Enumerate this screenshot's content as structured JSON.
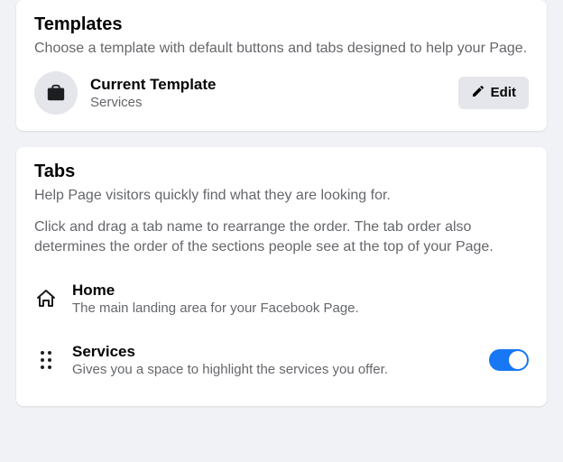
{
  "templates": {
    "title": "Templates",
    "description": "Choose a template with default buttons and tabs designed to help your Page.",
    "current_label": "Current Template",
    "current_value": "Services",
    "edit_label": "Edit"
  },
  "tabs": {
    "title": "Tabs",
    "description1": "Help Page visitors quickly find what they are looking for.",
    "description2": "Click and drag a tab name to rearrange the order. The tab order also determines the order of the sections people see at the top of your Page.",
    "items": [
      {
        "name": "Home",
        "description": "The main landing area for your Facebook Page.",
        "icon": "home",
        "draggable": false,
        "toggle": null
      },
      {
        "name": "Services",
        "description": "Gives you a space to highlight the services you offer.",
        "icon": "drag",
        "draggable": true,
        "toggle": true
      }
    ]
  }
}
